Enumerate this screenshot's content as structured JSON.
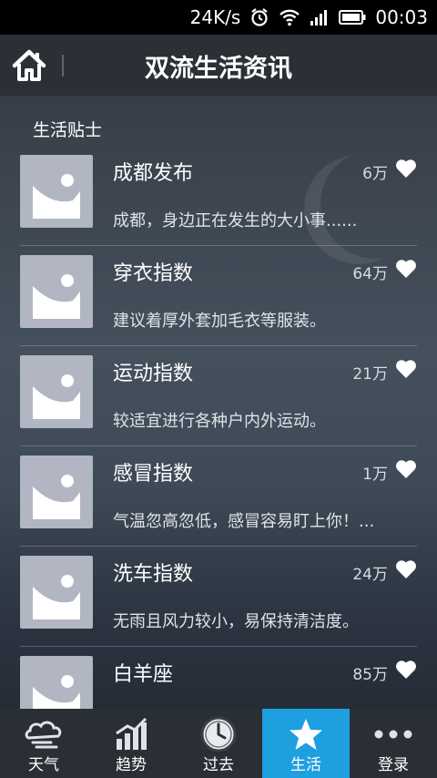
{
  "status_bar": {
    "speed": "24K/s",
    "time": "00:03"
  },
  "header": {
    "title": "双流生活资讯"
  },
  "section": {
    "label": "生活贴士"
  },
  "items": [
    {
      "title": "成都发布",
      "count": "6万",
      "desc": "成都，身边正在发生的大小事......"
    },
    {
      "title": "穿衣指数",
      "count": "64万",
      "desc": "建议着厚外套加毛衣等服装。"
    },
    {
      "title": "运动指数",
      "count": "21万",
      "desc": "较适宜进行各种户内外运动。"
    },
    {
      "title": "感冒指数",
      "count": "1万",
      "desc": "气温忽高忽低，感冒容易盯上你！..."
    },
    {
      "title": "洗车指数",
      "count": "24万",
      "desc": "无雨且风力较小，易保持清洁度。"
    },
    {
      "title": "白羊座",
      "count": "85万",
      "desc": ""
    }
  ],
  "nav": [
    {
      "label": "天气",
      "icon": "cloud-icon",
      "active": false
    },
    {
      "label": "趋势",
      "icon": "trend-chart-icon",
      "active": false
    },
    {
      "label": "过去",
      "icon": "clock-icon",
      "active": false
    },
    {
      "label": "生活",
      "icon": "star-icon",
      "active": true
    },
    {
      "label": "登录",
      "icon": "more-dots-icon",
      "active": false
    }
  ],
  "colors": {
    "accent": "#1e9fe0",
    "thumb_bg": "#b1b6c2",
    "status_bar_bg": "#000000"
  }
}
